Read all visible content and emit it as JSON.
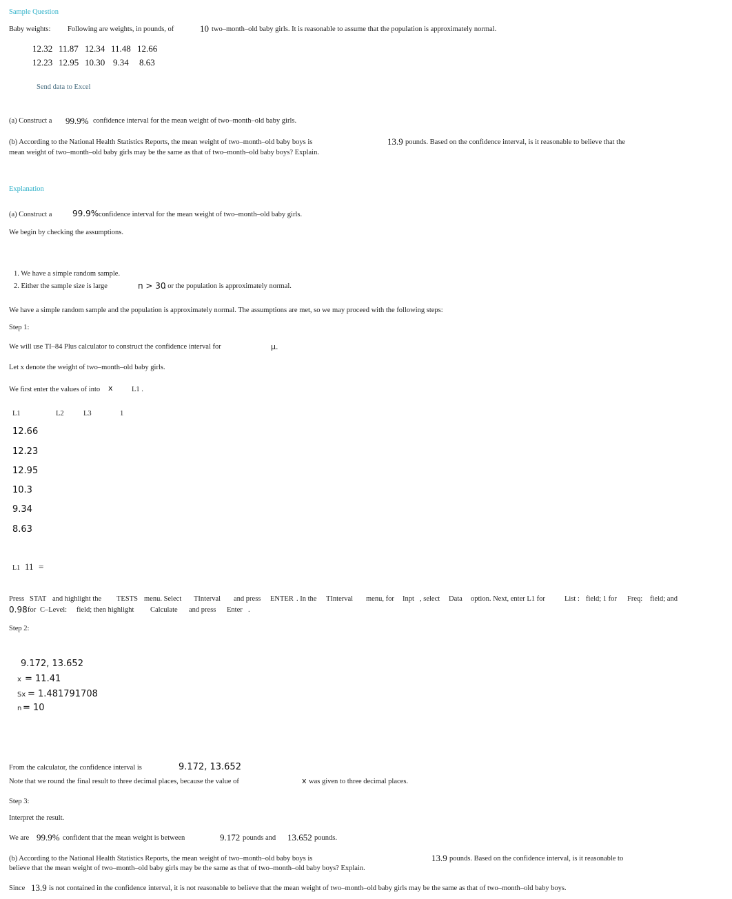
{
  "question": {
    "heading": "Sample Question",
    "label": "Baby weights:",
    "intro_pre": "Following are weights, in pounds, of",
    "n": "10",
    "intro_post": "two–month–old baby girls. It is reasonable to assume that the population is approximately normal.",
    "data_rows": [
      [
        "12.32",
        "11.87",
        "12.34",
        "11.48",
        "12.66"
      ],
      [
        "12.23",
        "12.95",
        "10.30",
        "9.34",
        "8.63"
      ]
    ],
    "excel_link": "Send data to Excel",
    "part_a_pre": "(a) Construct a",
    "confidence": "99.9%",
    "part_a_post": "confidence interval for the mean weight of two–month–old baby girls.",
    "part_b_pre": "(b) According to the National Health Statistics Reports, the mean weight of two–month–old baby boys is",
    "boys_mean": "13.9",
    "part_b_post": "pounds. Based on the confidence interval, is it reasonable to believe that the",
    "part_b_line2": "mean weight of two–month–old baby girls may be the same as that of two–month–old baby boys? Explain."
  },
  "explanation": {
    "heading": "Explanation",
    "part_a_pre": "(a) Construct a",
    "confidence": "99.9%",
    "part_a_post": "confidence interval for the mean weight of two–month–old baby girls.",
    "assumptions_intro": "We begin by checking the assumptions.",
    "assumptions": [
      "1. We have a simple random sample.",
      "2. Either the sample size is large"
    ],
    "assumption2_math": "n > 30",
    "assumption2_post": ", or the population is approximately normal.",
    "assumptions_met": "We have a simple random sample and the population is approximately normal. The assumptions are met, so we may proceed with the following steps:",
    "step1": {
      "label": "Step 1:",
      "line1_pre": "We will use TI–84 Plus calculator to construct the confidence interval for",
      "mu": "μ.",
      "line2": "Let x denote the weight of two–month–old baby girls.",
      "line3_pre": "We first enter the values of into",
      "line3_x": "x",
      "line3_list": "L1 .",
      "list_headers": [
        "L1",
        "L2",
        "L3",
        "1"
      ],
      "list_values": [
        "12.66",
        "12.23",
        "12.95",
        "10.3",
        "9.34",
        "8.63"
      ],
      "list_footer_label": "L1",
      "list_footer_value": "11",
      "list_footer_eq": "=",
      "instr": {
        "press": "Press",
        "stat": "STAT",
        "highlight": "and highlight the",
        "tests": "TESTS",
        "menu_select": "menu. Select",
        "tinterval": "TInterval",
        "and_press": "and press",
        "enter": "ENTER",
        "in_the": ". In the",
        "tinterval2": "TInterval",
        "menu_for": "menu, for",
        "inpt": "Inpt",
        "select": ", select",
        "data": "Data",
        "option": "option. Next, enter L1 for",
        "list": "List :",
        "field1": "field; 1 for",
        "freq": "Freq:",
        "field_and": "field; and",
        "clevel_value": "0.98",
        "for": "for",
        "clevel": "C–Level:",
        "field_then": "field; then highlight",
        "calculate": "Calculate",
        "and_press2": "and press",
        "enter2": "Enter",
        "period": "."
      }
    },
    "step2": {
      "label": "Step 2:",
      "interval": "9.172, 13.652",
      "xbar_label": "x",
      "xbar_value": "= 11.41",
      "sx_label": "Sx",
      "sx_value": "= 1.481791708",
      "n_label": "n",
      "n_value": "= 10",
      "from_calc_pre": "From the calculator, the confidence interval is",
      "from_calc_interval": "9.172, 13.652",
      "from_calc_post": ".",
      "note_pre": "Note that we round the final result to three decimal places, because the value of",
      "note_x": "x",
      "note_post": "was given to three decimal places."
    },
    "step3": {
      "label": "Step 3:",
      "interpret": "Interpret the result.",
      "we_are": "We are",
      "confidence": "99.9%",
      "confident_text": "confident that the mean weight is between",
      "lower": "9.172",
      "pounds_and": "pounds and",
      "upper": "13.652",
      "pounds": "pounds."
    },
    "part_b": {
      "pre": "(b) According to the National Health Statistics Reports, the mean weight of two–month–old baby boys is",
      "boys_mean": "13.9",
      "post": "pounds. Based on the confidence interval, is it reasonable to",
      "line2": "believe that the mean weight of two–month–old baby girls may be the same as that of two–month–old baby boys? Explain.",
      "since": "Since",
      "since_value": "13.9",
      "conclusion": "is not contained in the confidence interval, it is not reasonable to believe that the mean weight of two–month–old baby girls may be the same as that of two–month–old baby boys."
    }
  }
}
